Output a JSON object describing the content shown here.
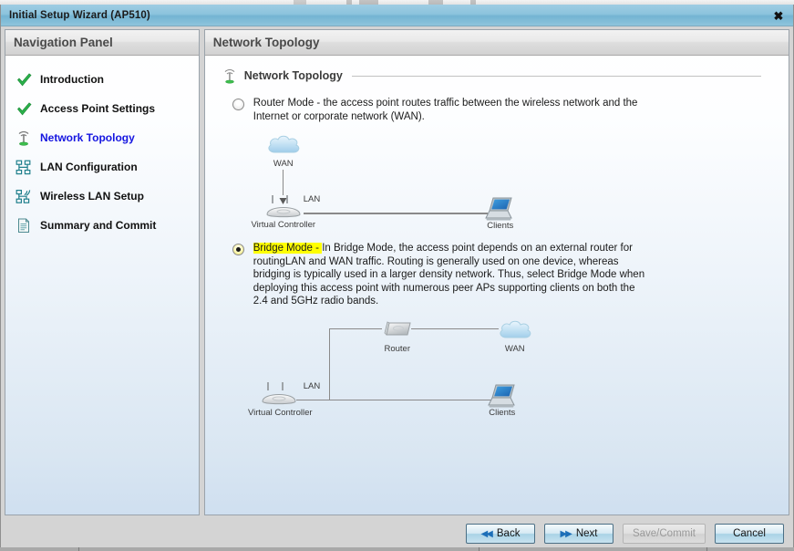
{
  "window": {
    "title": "Initial Setup Wizard (AP510)",
    "close_icon": "close-icon",
    "close_glyph": "✖"
  },
  "sidebar": {
    "header": "Navigation Panel",
    "items": [
      {
        "label": "Introduction",
        "icon": "green-check-icon",
        "state": "done"
      },
      {
        "label": "Access Point Settings",
        "icon": "green-check-icon",
        "state": "done"
      },
      {
        "label": "Network Topology",
        "icon": "antenna-icon",
        "state": "current"
      },
      {
        "label": "LAN Configuration",
        "icon": "network-nodes-icon",
        "state": "pending"
      },
      {
        "label": "Wireless LAN Setup",
        "icon": "wireless-nodes-icon",
        "state": "pending"
      },
      {
        "label": "Summary and Commit",
        "icon": "document-icon",
        "state": "pending"
      }
    ]
  },
  "content": {
    "header": "Network Topology",
    "section_title": "Network Topology",
    "section_icon": "antenna-icon",
    "modes": [
      {
        "id": "router-mode",
        "selected": false,
        "highlighted": false,
        "label": "Router Mode",
        "dash": " - ",
        "description": "the access point routes traffic between the wireless network and the Internet or corporate network (WAN)."
      },
      {
        "id": "bridge-mode",
        "selected": true,
        "highlighted": true,
        "label": "Bridge Mode",
        "dash": " - ",
        "description": "In Bridge Mode, the access point depends on an external router for routingLAN and WAN traffic. Routing is generally used on one device, whereas bridging is typically used in a larger density network. Thus, select Bridge Mode when deploying this access point with numerous peer APs supporting clients on both the 2.4 and 5GHz radio bands."
      }
    ],
    "diagram_router": {
      "name": "router-mode-topology-diagram",
      "nodes": [
        {
          "id": "wan",
          "label": "WAN",
          "icon": "cloud-icon"
        },
        {
          "id": "vc",
          "label": "Virtual Controller",
          "icon": "access-point-icon"
        },
        {
          "id": "clients",
          "label": "Clients",
          "icon": "laptop-icon"
        }
      ],
      "link_labels": [
        "LAN"
      ]
    },
    "diagram_bridge": {
      "name": "bridge-mode-topology-diagram",
      "nodes": [
        {
          "id": "router",
          "label": "Router",
          "icon": "router-icon"
        },
        {
          "id": "wan",
          "label": "WAN",
          "icon": "cloud-icon"
        },
        {
          "id": "vc",
          "label": "Virtual Controller",
          "icon": "access-point-icon"
        },
        {
          "id": "clients",
          "label": "Clients",
          "icon": "laptop-icon"
        }
      ],
      "link_labels": [
        "LAN"
      ]
    }
  },
  "buttons": [
    {
      "id": "back",
      "label": "Back",
      "icon": "double-left-arrow-icon",
      "glyph": "◀◀",
      "enabled": true
    },
    {
      "id": "next",
      "label": "Next",
      "icon": "double-right-arrow-icon",
      "glyph": "▶▶",
      "enabled": true
    },
    {
      "id": "save-commit",
      "label": "Save/Commit",
      "icon": "",
      "glyph": "",
      "enabled": false
    },
    {
      "id": "cancel",
      "label": "Cancel",
      "icon": "",
      "glyph": "",
      "enabled": true
    }
  ],
  "colors": {
    "titlebar": "#8cc3dd",
    "link_current": "#1515e0",
    "highlight": "#ffff00",
    "check_green": "#2bb14b",
    "icon_teal": "#1f7f8c",
    "wire_gray": "#8a8a8a"
  }
}
